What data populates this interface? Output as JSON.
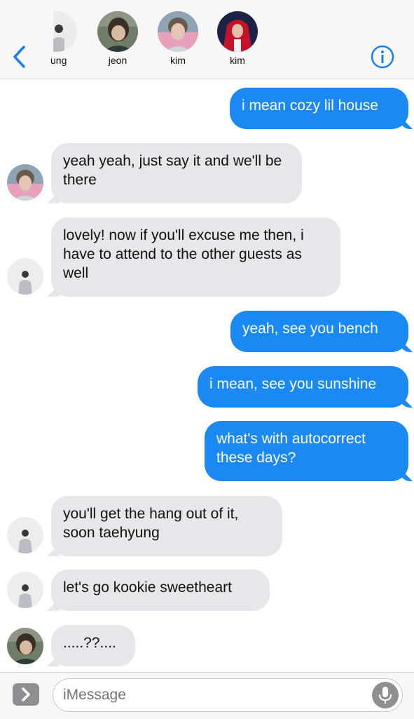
{
  "header": {
    "contacts": [
      {
        "name": "ung",
        "avatar": "person-avatar"
      },
      {
        "name": "jeon",
        "avatar": "person-avatar"
      },
      {
        "name": "kim",
        "avatar": "person-avatar"
      },
      {
        "name": "kim",
        "avatar": "person-avatar"
      }
    ],
    "back_icon": "chevron-left-icon",
    "info_icon": "info-icon"
  },
  "messages": [
    {
      "side": "out",
      "text": "i mean cozy lil house"
    },
    {
      "side": "in",
      "text": "yeah yeah, just say it and we'll be there"
    },
    {
      "side": "in",
      "text": "lovely! now if you'll excuse me then, i have to attend to the other guests as well"
    },
    {
      "side": "out",
      "text": "yeah, see you bench"
    },
    {
      "side": "out",
      "text": "i mean, see you sunshine"
    },
    {
      "side": "out",
      "text": "what's with autocorrect these days?"
    },
    {
      "side": "in",
      "text": "you'll get the hang out of it, soon taehyung"
    },
    {
      "side": "in",
      "text": "let's go kookie sweetheart"
    },
    {
      "side": "in",
      "text": ".....??...."
    }
  ],
  "composer": {
    "placeholder": "iMessage",
    "expand_icon": "chevron-right-icon",
    "mic_icon": "microphone-icon"
  },
  "colors": {
    "outgoing_bubble": "#1a89f4",
    "incoming_bubble": "#e6e6eb",
    "accent": "#1a7ef2"
  }
}
